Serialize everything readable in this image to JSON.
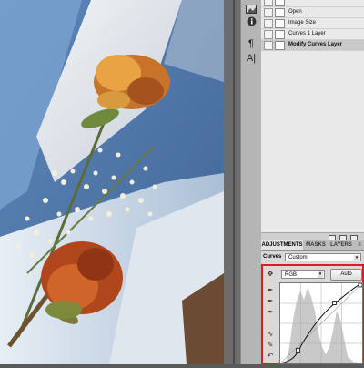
{
  "history": {
    "items": [
      {
        "label": ""
      },
      {
        "label": "Open"
      },
      {
        "label": "Image Size"
      },
      {
        "label": "Curves 1 Layer"
      },
      {
        "label": "Modify Curves Layer",
        "active": true
      }
    ]
  },
  "adjustments": {
    "tabs": [
      {
        "label": "ADJUSTMENTS",
        "active": true
      },
      {
        "label": "MASKS"
      },
      {
        "label": "LAYERS"
      }
    ],
    "curves_label": "Curves",
    "preset_value": "Custom",
    "channel_value": "RGB",
    "auto_label": "Auto"
  },
  "icons": {
    "tools": [
      "image-icon",
      "info-icon",
      "paragraph-icon",
      "character-icon"
    ],
    "curve_tools": [
      "hand-adjust-icon",
      "black-eyedropper-icon",
      "gray-eyedropper-icon",
      "white-eyedropper-icon",
      "curve-point-icon",
      "pencil-icon",
      "smooth-icon"
    ]
  },
  "colors": {
    "highlight_border": "#d42020",
    "panel_bg": "#d9d9d9"
  }
}
